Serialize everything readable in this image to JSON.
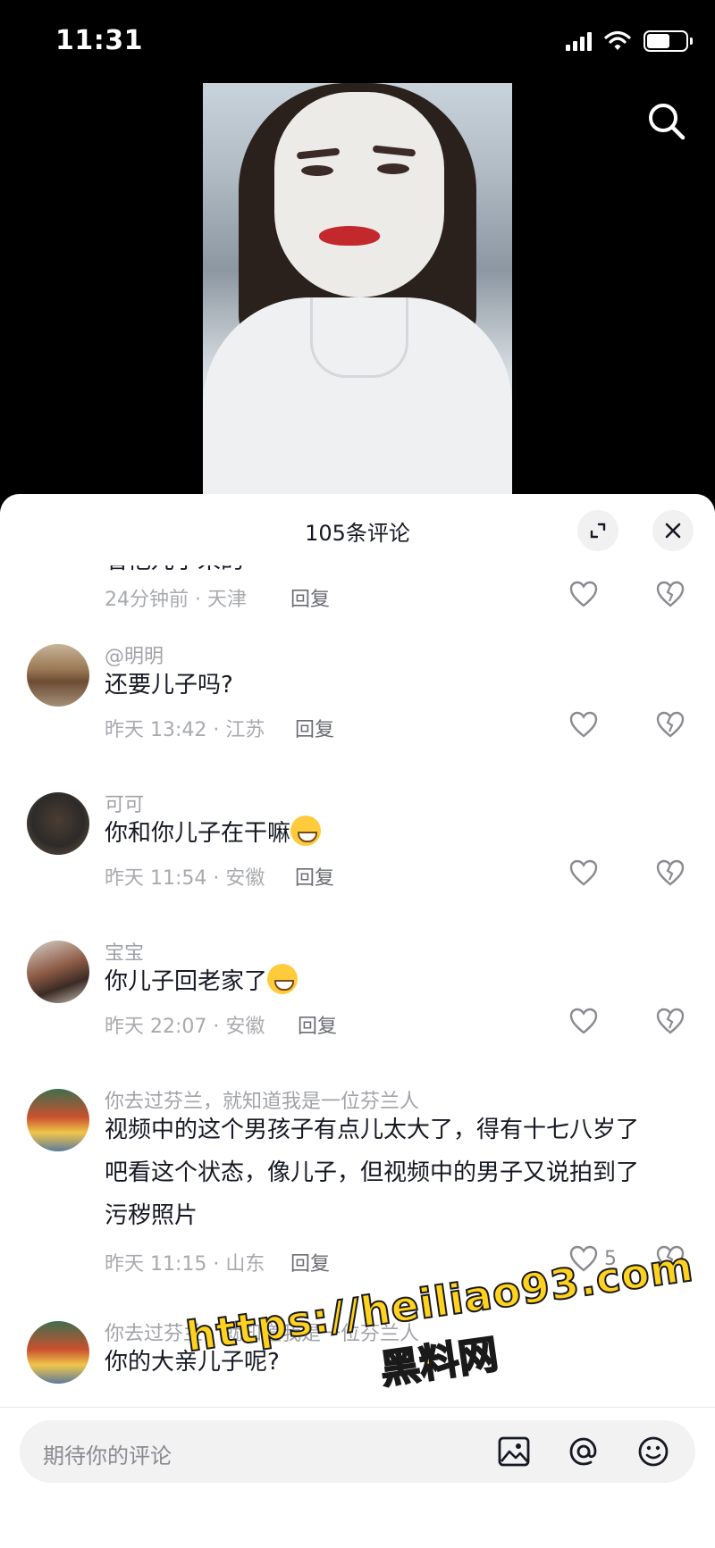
{
  "status_bar": {
    "time": "11:31"
  },
  "sheet": {
    "title": "105条评论"
  },
  "comments_partial": {
    "text": "看他儿子来的",
    "time_location": "24分钟前 · 天津",
    "reply": "回复"
  },
  "comments": [
    {
      "user": "@明明",
      "text": "还要儿子吗?",
      "time_location": "昨天 13:42 · 江苏",
      "reply": "回复",
      "likes": ""
    },
    {
      "user": "可可",
      "text": "你和你儿子在干嘛",
      "emoji": "grinning-sweat-emoji",
      "time_location": "昨天 11:54 · 安徽",
      "reply": "回复",
      "likes": ""
    },
    {
      "user": "宝宝",
      "text": "你儿子回老家了",
      "emoji": "grinning-emoji",
      "time_location": "昨天 22:07 · 安徽",
      "reply": "回复",
      "likes": ""
    },
    {
      "user": "你去过芬兰，就知道我是一位芬兰人",
      "text_lines": [
        "视频中的这个男孩子有点儿太大了，得有十七八岁了",
        "吧看这个状态，像儿子，但视频中的男子又说拍到了",
        "污秽照片"
      ],
      "time_location": "昨天 11:15 · 山东",
      "reply": "回复",
      "likes": "5"
    },
    {
      "user": "你去过芬兰，就知道我是一位芬兰人",
      "text": "你的大亲儿子呢?",
      "time_location": "",
      "reply": "",
      "likes": ""
    }
  ],
  "input": {
    "placeholder": "期待你的评论"
  },
  "watermark": {
    "line1": "https://heiliao93.com",
    "line2": "黑料网"
  },
  "colors": {
    "background": "#000000",
    "sheet": "#ffffff",
    "watermark": "#ffd21f",
    "text": "#161823",
    "meta": "#a8aaae"
  }
}
